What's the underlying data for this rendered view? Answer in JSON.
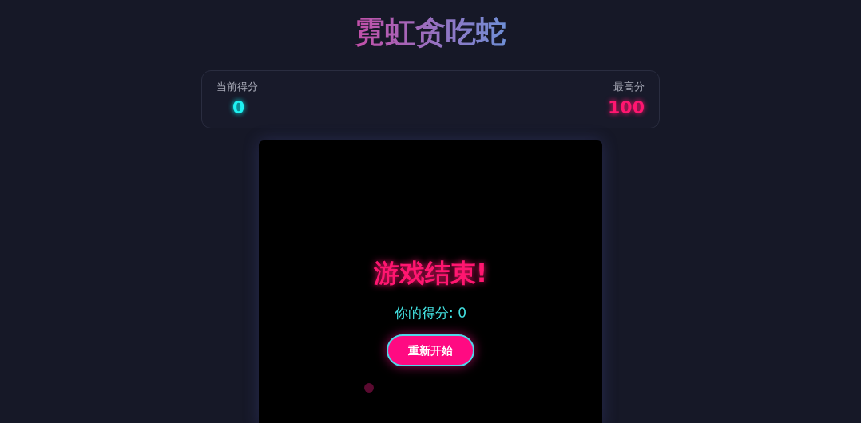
{
  "title": "霓虹贪吃蛇",
  "scores": [
    {
      "label": "当前得分",
      "value": "0",
      "kind": "current"
    },
    {
      "label": "最高分",
      "value": "100",
      "kind": "best"
    }
  ],
  "game_over": {
    "heading": "游戏结束!",
    "score_text": "你的得分: 0",
    "button": "重新开始"
  }
}
